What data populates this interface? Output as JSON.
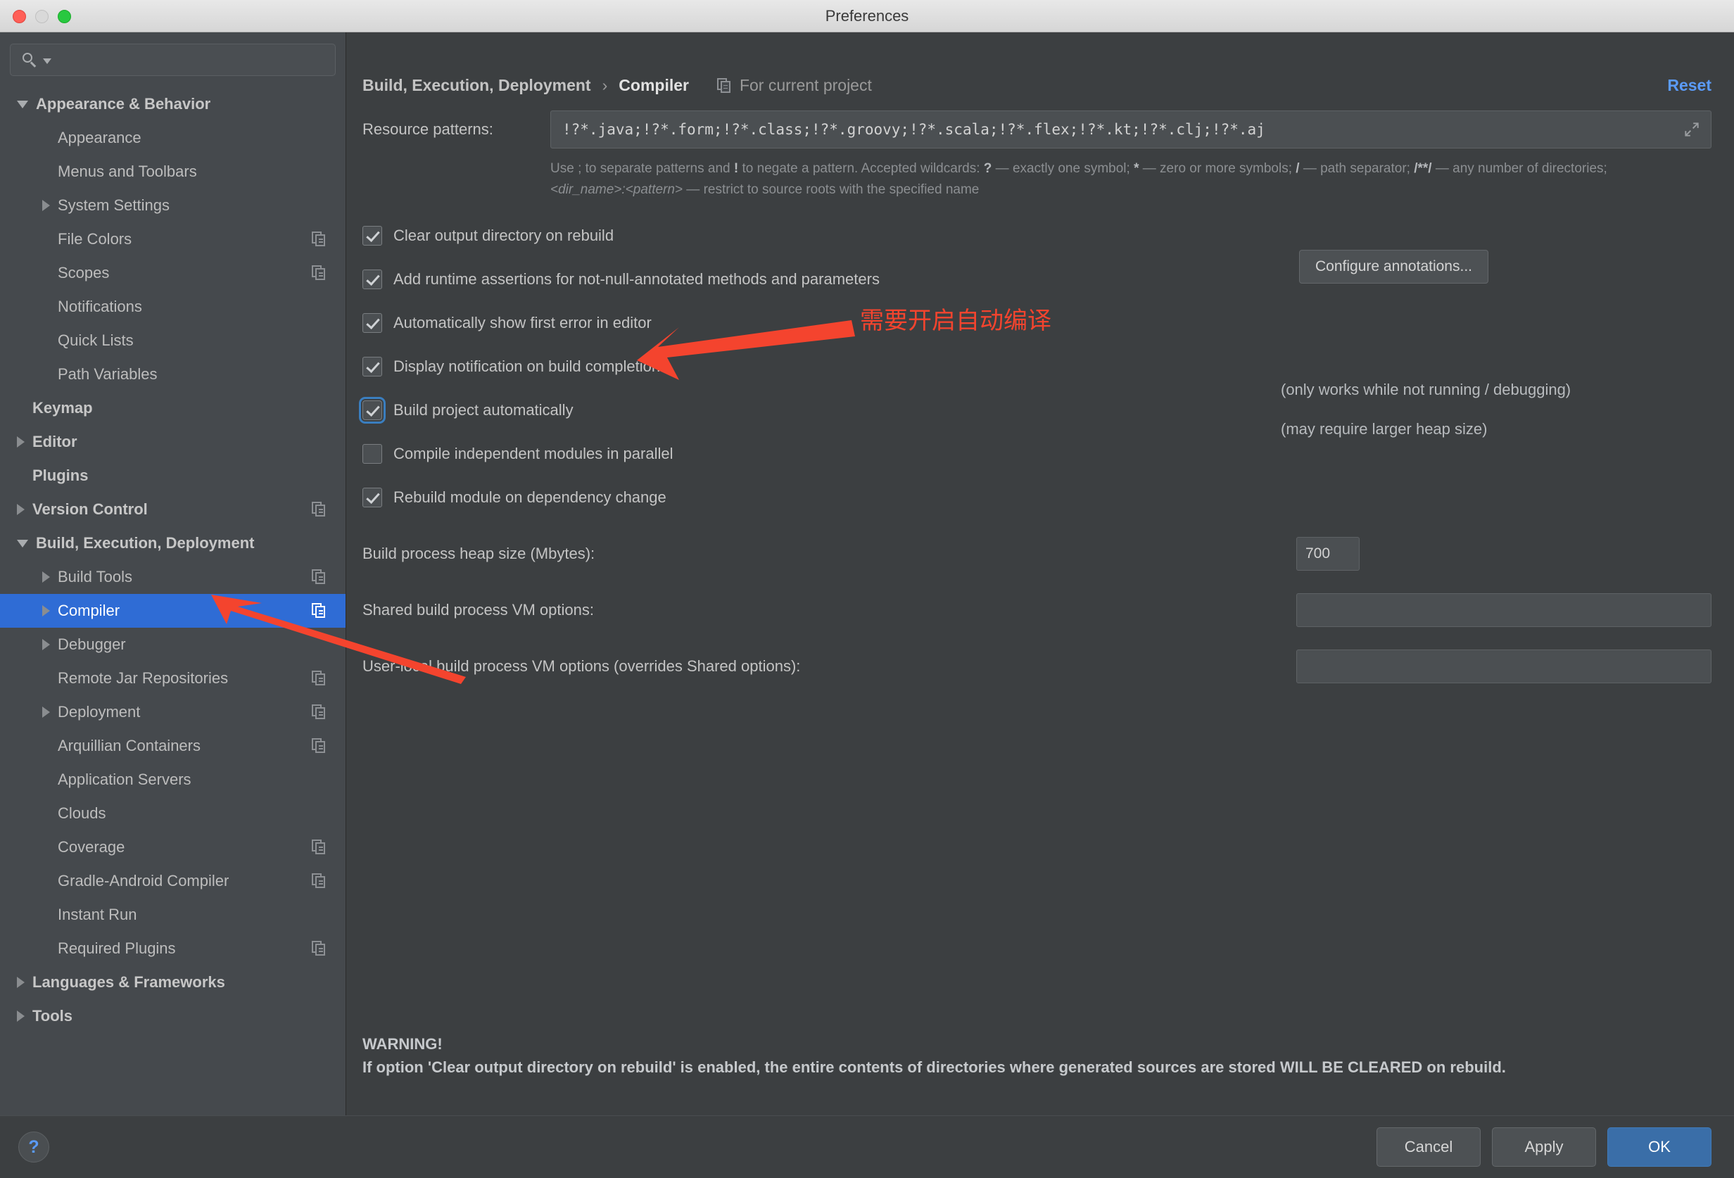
{
  "window": {
    "title": "Preferences",
    "traffic_lights": [
      "close-button",
      "minimize-button",
      "zoom-button"
    ]
  },
  "sidebar": {
    "search": {
      "value": "",
      "placeholder": ""
    },
    "items": [
      {
        "label": "Appearance & Behavior",
        "indent": 0,
        "twisty": "down",
        "bold": true,
        "project_icon": false,
        "selected": false
      },
      {
        "label": "Appearance",
        "indent": 1,
        "twisty": "none",
        "bold": false,
        "project_icon": false,
        "selected": false
      },
      {
        "label": "Menus and Toolbars",
        "indent": 1,
        "twisty": "none",
        "bold": false,
        "project_icon": false,
        "selected": false
      },
      {
        "label": "System Settings",
        "indent": 1,
        "twisty": "right",
        "bold": false,
        "project_icon": false,
        "selected": false
      },
      {
        "label": "File Colors",
        "indent": 1,
        "twisty": "none",
        "bold": false,
        "project_icon": true,
        "selected": false
      },
      {
        "label": "Scopes",
        "indent": 1,
        "twisty": "none",
        "bold": false,
        "project_icon": true,
        "selected": false
      },
      {
        "label": "Notifications",
        "indent": 1,
        "twisty": "none",
        "bold": false,
        "project_icon": false,
        "selected": false
      },
      {
        "label": "Quick Lists",
        "indent": 1,
        "twisty": "none",
        "bold": false,
        "project_icon": false,
        "selected": false
      },
      {
        "label": "Path Variables",
        "indent": 1,
        "twisty": "none",
        "bold": false,
        "project_icon": false,
        "selected": false
      },
      {
        "label": "Keymap",
        "indent": 0,
        "twisty": "none",
        "bold": true,
        "project_icon": false,
        "selected": false
      },
      {
        "label": "Editor",
        "indent": 0,
        "twisty": "right",
        "bold": true,
        "project_icon": false,
        "selected": false
      },
      {
        "label": "Plugins",
        "indent": 0,
        "twisty": "none",
        "bold": true,
        "project_icon": false,
        "selected": false
      },
      {
        "label": "Version Control",
        "indent": 0,
        "twisty": "right",
        "bold": true,
        "project_icon": true,
        "selected": false
      },
      {
        "label": "Build, Execution, Deployment",
        "indent": 0,
        "twisty": "down",
        "bold": true,
        "project_icon": false,
        "selected": false
      },
      {
        "label": "Build Tools",
        "indent": 1,
        "twisty": "right",
        "bold": false,
        "project_icon": true,
        "selected": false
      },
      {
        "label": "Compiler",
        "indent": 1,
        "twisty": "right",
        "bold": false,
        "project_icon": true,
        "selected": true
      },
      {
        "label": "Debugger",
        "indent": 1,
        "twisty": "right",
        "bold": false,
        "project_icon": false,
        "selected": false
      },
      {
        "label": "Remote Jar Repositories",
        "indent": 1,
        "twisty": "none",
        "bold": false,
        "project_icon": true,
        "selected": false
      },
      {
        "label": "Deployment",
        "indent": 1,
        "twisty": "right",
        "bold": false,
        "project_icon": true,
        "selected": false
      },
      {
        "label": "Arquillian Containers",
        "indent": 1,
        "twisty": "none",
        "bold": false,
        "project_icon": true,
        "selected": false
      },
      {
        "label": "Application Servers",
        "indent": 1,
        "twisty": "none",
        "bold": false,
        "project_icon": false,
        "selected": false
      },
      {
        "label": "Clouds",
        "indent": 1,
        "twisty": "none",
        "bold": false,
        "project_icon": false,
        "selected": false
      },
      {
        "label": "Coverage",
        "indent": 1,
        "twisty": "none",
        "bold": false,
        "project_icon": true,
        "selected": false
      },
      {
        "label": "Gradle-Android Compiler",
        "indent": 1,
        "twisty": "none",
        "bold": false,
        "project_icon": true,
        "selected": false
      },
      {
        "label": "Instant Run",
        "indent": 1,
        "twisty": "none",
        "bold": false,
        "project_icon": false,
        "selected": false
      },
      {
        "label": "Required Plugins",
        "indent": 1,
        "twisty": "none",
        "bold": false,
        "project_icon": true,
        "selected": false
      },
      {
        "label": "Languages & Frameworks",
        "indent": 0,
        "twisty": "right",
        "bold": true,
        "project_icon": false,
        "selected": false
      },
      {
        "label": "Tools",
        "indent": 0,
        "twisty": "right",
        "bold": true,
        "project_icon": false,
        "selected": false
      }
    ]
  },
  "header": {
    "breadcrumb_parent": "Build, Execution, Deployment",
    "breadcrumb_separator": "›",
    "breadcrumb_current": "Compiler",
    "scope_label": "For current project",
    "reset_label": "Reset"
  },
  "main": {
    "resource_patterns": {
      "label": "Resource patterns:",
      "value": "!?*.java;!?*.form;!?*.class;!?*.groovy;!?*.scala;!?*.flex;!?*.kt;!?*.clj;!?*.aj",
      "expand_icon": "expand-arrows-icon"
    },
    "hint_line1_a": "Use ; to separate patterns and ",
    "hint_bang": "!",
    "hint_line1_b": " to negate a pattern. Accepted wildcards: ",
    "hint_q": "?",
    "hint_line1_c": " — exactly one symbol; ",
    "hint_star": "*",
    "hint_line1_d": " — zero or more symbols; ",
    "hint_slash": "/",
    "hint_line1_e": " — path separator; ",
    "hint_dstar": "/**/",
    "hint_line1_f": " — any number of directories; ",
    "hint_dirname": "<dir_name>:<pattern>",
    "hint_line1_g": " — restrict to source roots with the specified name",
    "checkboxes": [
      {
        "label": "Clear output directory on rebuild",
        "checked": true,
        "focused": false
      },
      {
        "label": "Add runtime assertions for not-null-annotated methods and parameters",
        "checked": true,
        "focused": false
      },
      {
        "label": "Automatically show first error in editor",
        "checked": true,
        "focused": false
      },
      {
        "label": "Display notification on build completion",
        "checked": true,
        "focused": false
      },
      {
        "label": "Build project automatically",
        "checked": true,
        "focused": true
      },
      {
        "label": "Compile independent modules in parallel",
        "checked": false,
        "focused": false
      },
      {
        "label": "Rebuild module on dependency change",
        "checked": true,
        "focused": false
      }
    ],
    "configure_annotations_label": "Configure annotations...",
    "note_build_auto": "(only works while not running / debugging)",
    "note_parallel": "(may require larger heap size)",
    "heap": {
      "label": "Build process heap size (Mbytes):",
      "value": "700"
    },
    "shared_vm": {
      "label": "Shared build process VM options:",
      "value": ""
    },
    "userlocal_vm": {
      "label": "User-local build process VM options (overrides Shared options):",
      "value": ""
    },
    "warning_title": "WARNING!",
    "warning_body": "If option 'Clear output directory on rebuild' is enabled, the entire contents of directories where generated sources are stored WILL BE CLEARED on rebuild."
  },
  "footer": {
    "help_label": "?",
    "cancel_label": "Cancel",
    "apply_label": "Apply",
    "ok_label": "OK"
  },
  "annotation": {
    "chinese_note": "需要开启自动编译",
    "color": "#f4442e",
    "arrow_to_checkbox": "arrow-pointing-to-build-project-automatically",
    "arrow_to_compiler": "arrow-pointing-to-compiler-sidebar-item"
  }
}
